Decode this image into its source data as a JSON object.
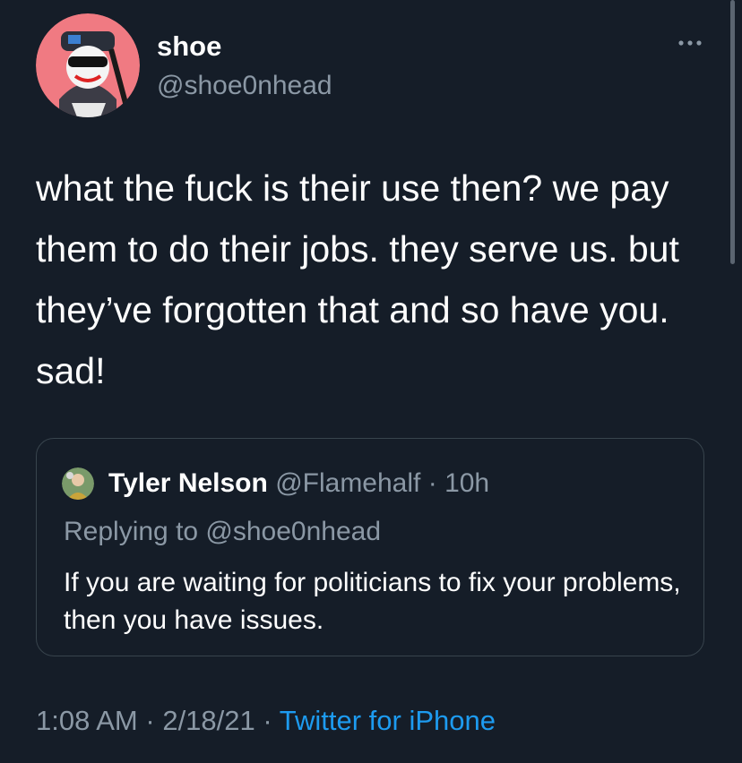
{
  "author": {
    "display_name": "shoe",
    "handle": "@shoe0nhead"
  },
  "tweet": {
    "text": "what the fuck is their use then? we pay them to do their jobs. they serve us. but they’ve forgotten that and so have you. sad!",
    "time": "1:08 AM",
    "date": "2/18/21",
    "separator": "·",
    "source": "Twitter for iPhone"
  },
  "quote": {
    "display_name": "Tyler Nelson",
    "handle": "@Flamehalf",
    "separator": "·",
    "age": "10h",
    "replying_to": "Replying to @shoe0nhead",
    "text": "If you are waiting for politicians to fix your problems, then you have issues."
  },
  "icons": {
    "more": "more-horizontal-icon"
  },
  "colors": {
    "background": "#151d28",
    "secondary_text": "#8b98a5",
    "link": "#1d9bf0",
    "border": "#38444d"
  }
}
